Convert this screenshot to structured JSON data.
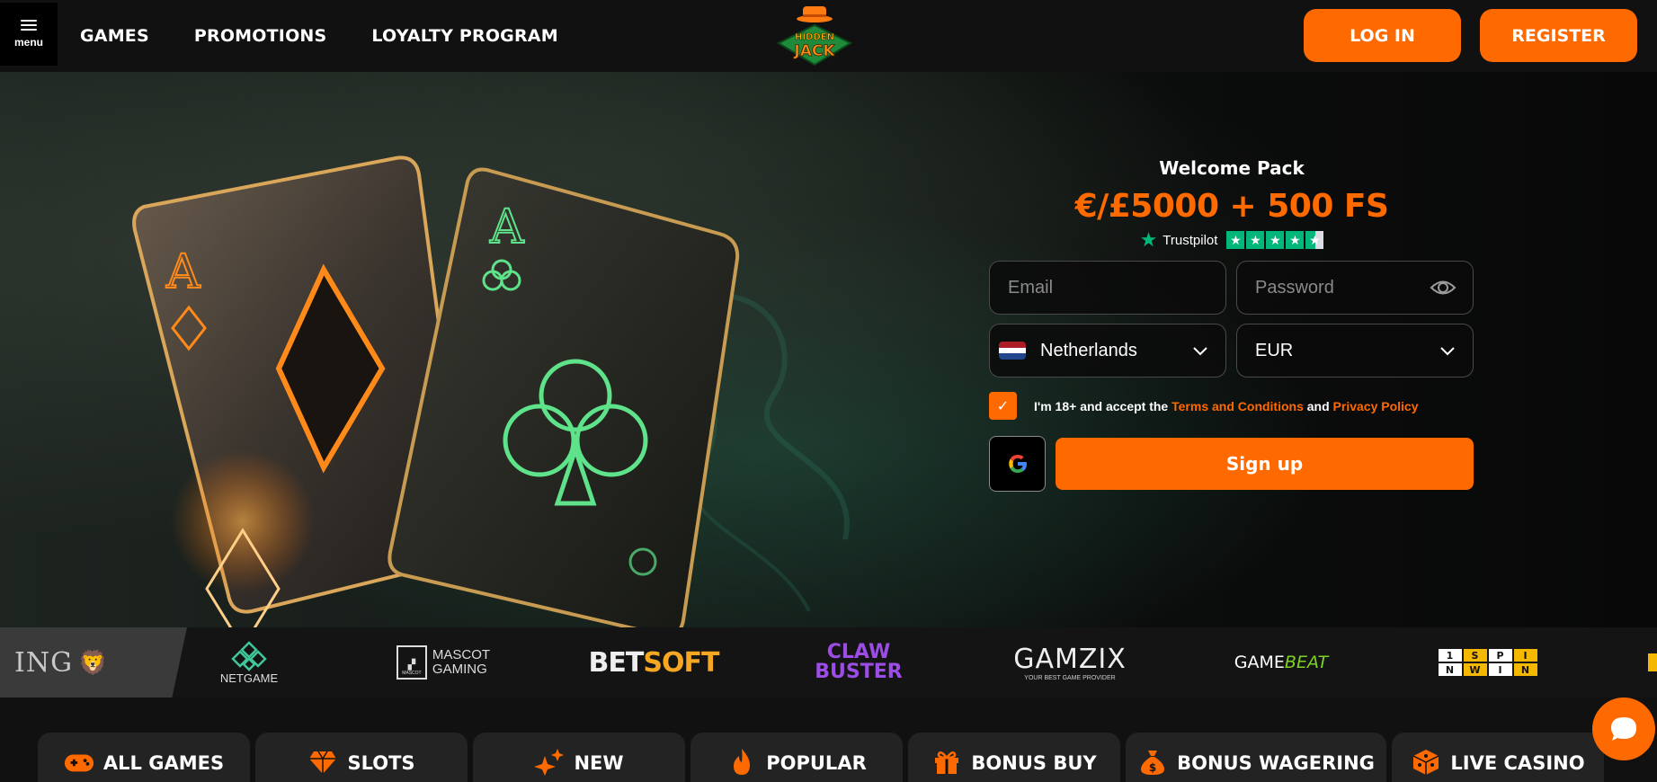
{
  "header": {
    "menu_label": "menu",
    "nav": [
      "GAMES",
      "PROMOTIONS",
      "LOYALTY PROGRAM"
    ],
    "logo_text_top": "HIDDEN",
    "logo_text_bottom": "JACK",
    "login_label": "LOG IN",
    "register_label": "REGISTER"
  },
  "hero": {
    "card1_rank": "A",
    "card2_rank": "A"
  },
  "promo": {
    "title": "Welcome Pack",
    "amount": "€/£5000 + 500 FS",
    "trustpilot_label": "Trustpilot",
    "trustpilot_stars": 4.5
  },
  "form": {
    "email_placeholder": "Email",
    "password_placeholder": "Password",
    "country": "Netherlands",
    "currency": "EUR",
    "agree_prefix": "I'm 18+ and accept the ",
    "terms_link": "Terms and Conditions",
    "agree_and": " and ",
    "privacy_link": "Privacy Policy",
    "checkbox_checked": true,
    "signup_label": "Sign up"
  },
  "providers": {
    "ing": "ING",
    "netgame": "NETGAME",
    "mascot_line1": "MASCOT",
    "mascot_line2": "GAMING",
    "mascot_badge": "MASCOT",
    "betsoft_a": "BET",
    "betsoft_b": "SOFT",
    "claw_line1": "CLAW",
    "claw_line2": "BUSTER",
    "gamzix": "GAMZIX",
    "gamzix_sub": "YOUR BEST GAME PROVIDER",
    "gamebeat_a": "GAME",
    "gamebeat_b": "BEAT",
    "spinwin": [
      "1",
      "S",
      "P",
      "I",
      "N",
      "W",
      "I",
      "N"
    ]
  },
  "categories": [
    {
      "label": "ALL GAMES",
      "icon": "gamepad-icon"
    },
    {
      "label": "SLOTS",
      "icon": "diamond-icon"
    },
    {
      "label": "NEW",
      "icon": "sparkle-icon"
    },
    {
      "label": "POPULAR",
      "icon": "flame-icon"
    },
    {
      "label": "BONUS BUY",
      "icon": "gift-icon"
    },
    {
      "label": "BONUS WAGERING",
      "icon": "money-bag-icon"
    },
    {
      "label": "LIVE CASINO",
      "icon": "dice-icon"
    }
  ],
  "colors": {
    "accent": "#ff6a00",
    "trustpilot": "#00b67a",
    "background": "#111111"
  }
}
